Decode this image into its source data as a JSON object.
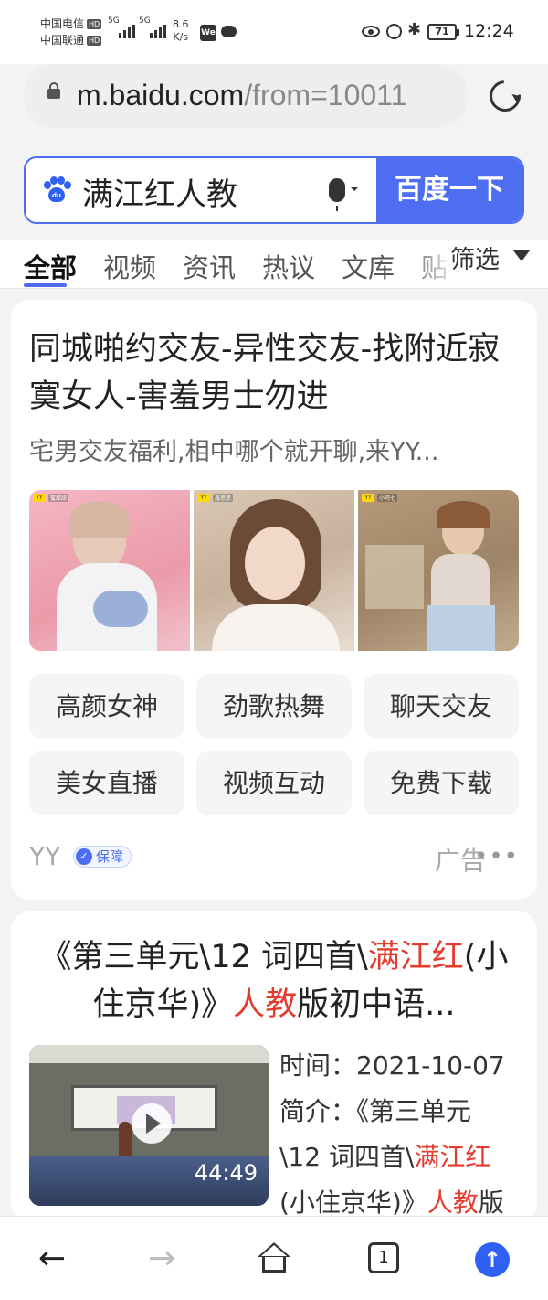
{
  "status_bar": {
    "carrier1": "中国电信",
    "carrier2": "中国联通",
    "hd": "HD",
    "net1": "5G",
    "net2": "5G",
    "speed_value": "8.6",
    "speed_unit": "K/s",
    "wechat_icon": "We",
    "battery": "71",
    "time": "12:24"
  },
  "url_bar": {
    "host": "m.baidu.com",
    "path": "/from=10011"
  },
  "search": {
    "query": "满江红人教",
    "button": "百度一下",
    "logo_text": "du"
  },
  "tabs": {
    "items": [
      "全部",
      "视频",
      "资讯",
      "热议",
      "文库",
      "贴"
    ],
    "active_index": 0,
    "filter": "筛选"
  },
  "ad_card": {
    "title": "同城啪约交友-异性交友-找附近寂寞女人-害羞男士勿进",
    "description": "宅男交友福利,相中哪个就开聊,来YY...",
    "photo_names": [
      "蜜甜甜",
      "鑫思思",
      "小阿七"
    ],
    "photo_badge": "YY",
    "chips": [
      "高颜女神",
      "劲歌热舞",
      "聊天交友",
      "美女直播",
      "视频互动",
      "免费下载"
    ],
    "brand": "YY",
    "guarantee": "保障",
    "ad_label": "广告",
    "more": "•••"
  },
  "result_card": {
    "title_part1": "《第三单元\\12 词四首\\",
    "title_hl1": "满江红",
    "title_part2": "(小住京华)》",
    "title_hl2": "人教",
    "title_part3": "版初中语...",
    "duration": "44:49",
    "time_label": "时间：",
    "time_value": "2021-10-07",
    "intro_label": "简介：",
    "intro_part1": "《第三单元",
    "intro_part2": "\\12 词四首\\",
    "intro_hl1": "满江红",
    "intro_part3": "(小住京华)》",
    "intro_hl2": "人教",
    "intro_part4": "版"
  },
  "bottom_nav": {
    "back": "←",
    "forward": "→",
    "tab_count": "1",
    "up": "↑"
  },
  "colors": {
    "accent": "#4e6ef2",
    "highlight": "#e53b2e",
    "background": "#f2f3f5"
  }
}
